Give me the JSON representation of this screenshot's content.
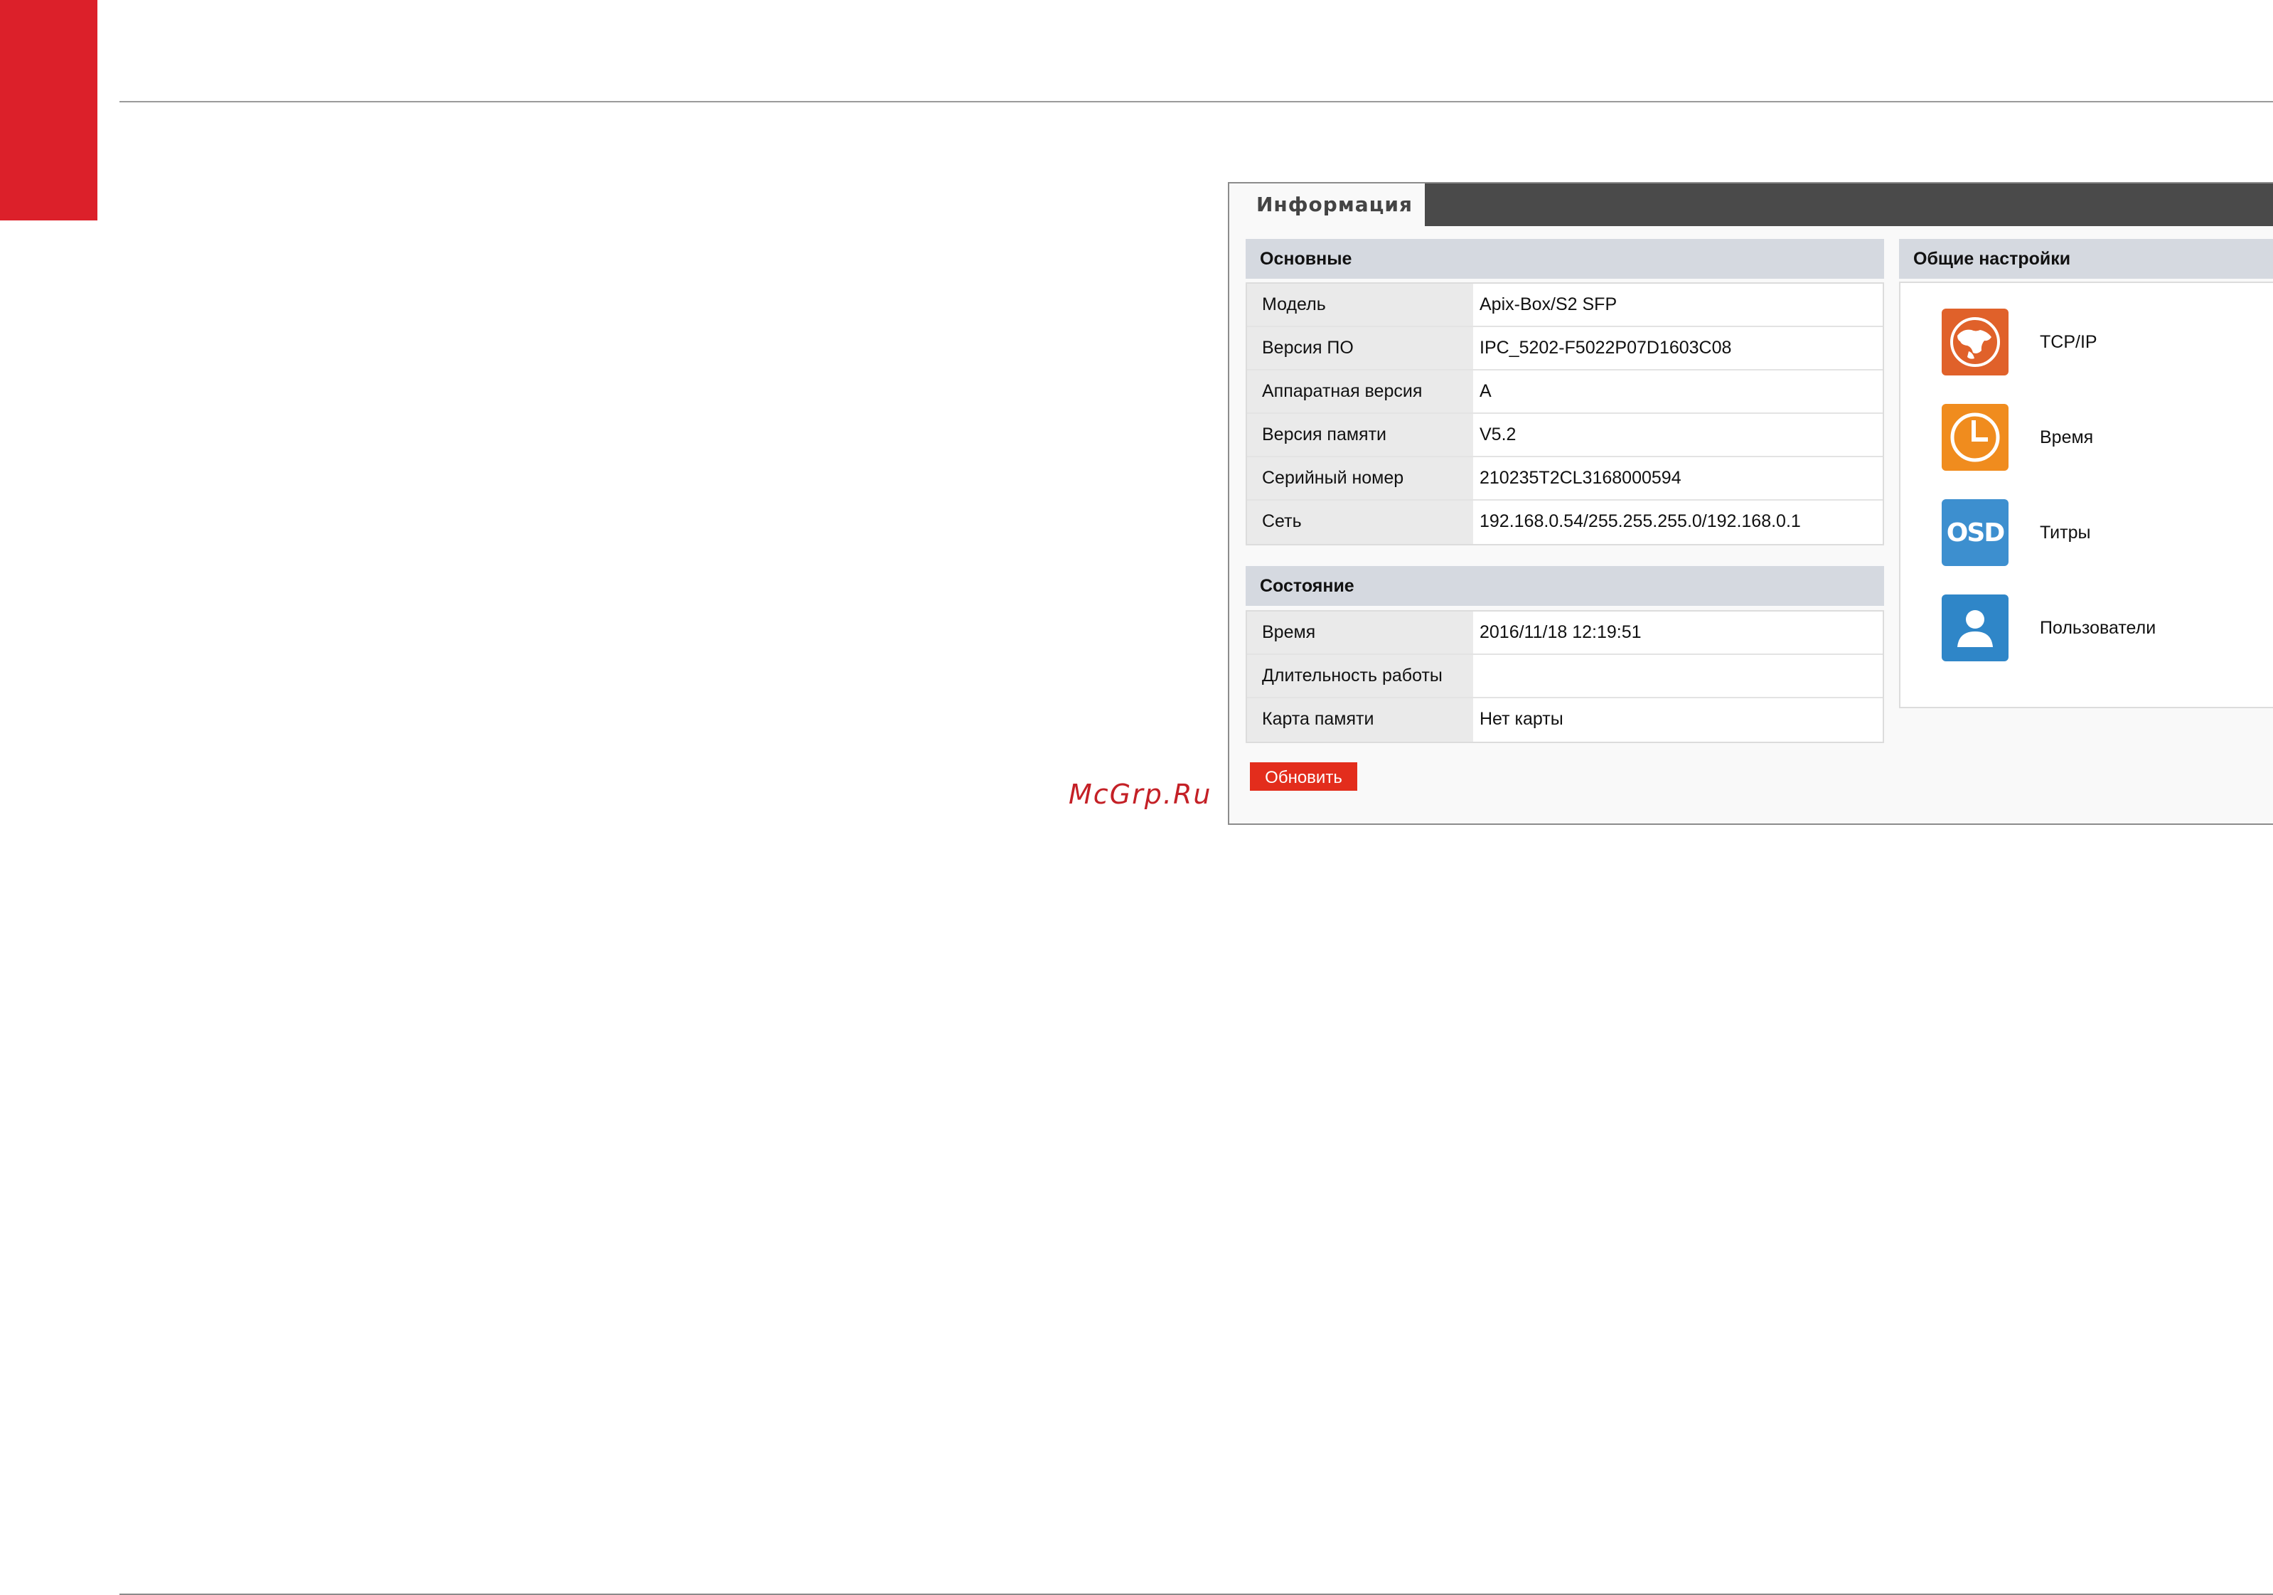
{
  "tab": {
    "label": "Информация"
  },
  "basic": {
    "title": "Основные",
    "rows": [
      {
        "label": "Модель",
        "value": "Apix-Box/S2 SFP"
      },
      {
        "label": "Версия ПО",
        "value": "IPC_5202-F5022P07D1603C08"
      },
      {
        "label": "Аппаратная версия",
        "value": "A"
      },
      {
        "label": "Версия памяти",
        "value": "V5.2"
      },
      {
        "label": "Серийный номер",
        "value": "210235T2CL3168000594"
      },
      {
        "label": "Сеть",
        "value": "192.168.0.54/255.255.255.0/192.168.0.1"
      }
    ]
  },
  "status": {
    "title": "Состояние",
    "rows": [
      {
        "label": "Время",
        "value": "2016/11/18 12:19:51"
      },
      {
        "label": "Длительность работы",
        "value": ""
      },
      {
        "label": "Карта памяти",
        "value": "Нет карты"
      }
    ]
  },
  "general": {
    "title": "Общие настройки",
    "items": [
      {
        "label": "TCP/IP",
        "icon": "globe-icon",
        "color": "#e0612a"
      },
      {
        "label": "Время",
        "icon": "clock-icon",
        "color": "#f08c1e"
      },
      {
        "label": "Титры",
        "icon": "osd-icon",
        "color": "#3d8fcf",
        "icon_text": "OSD"
      },
      {
        "label": "Пользователи",
        "icon": "user-icon",
        "color": "#2f86c8"
      }
    ]
  },
  "refresh_button": "Обновить",
  "watermark": "McGrp.Ru"
}
